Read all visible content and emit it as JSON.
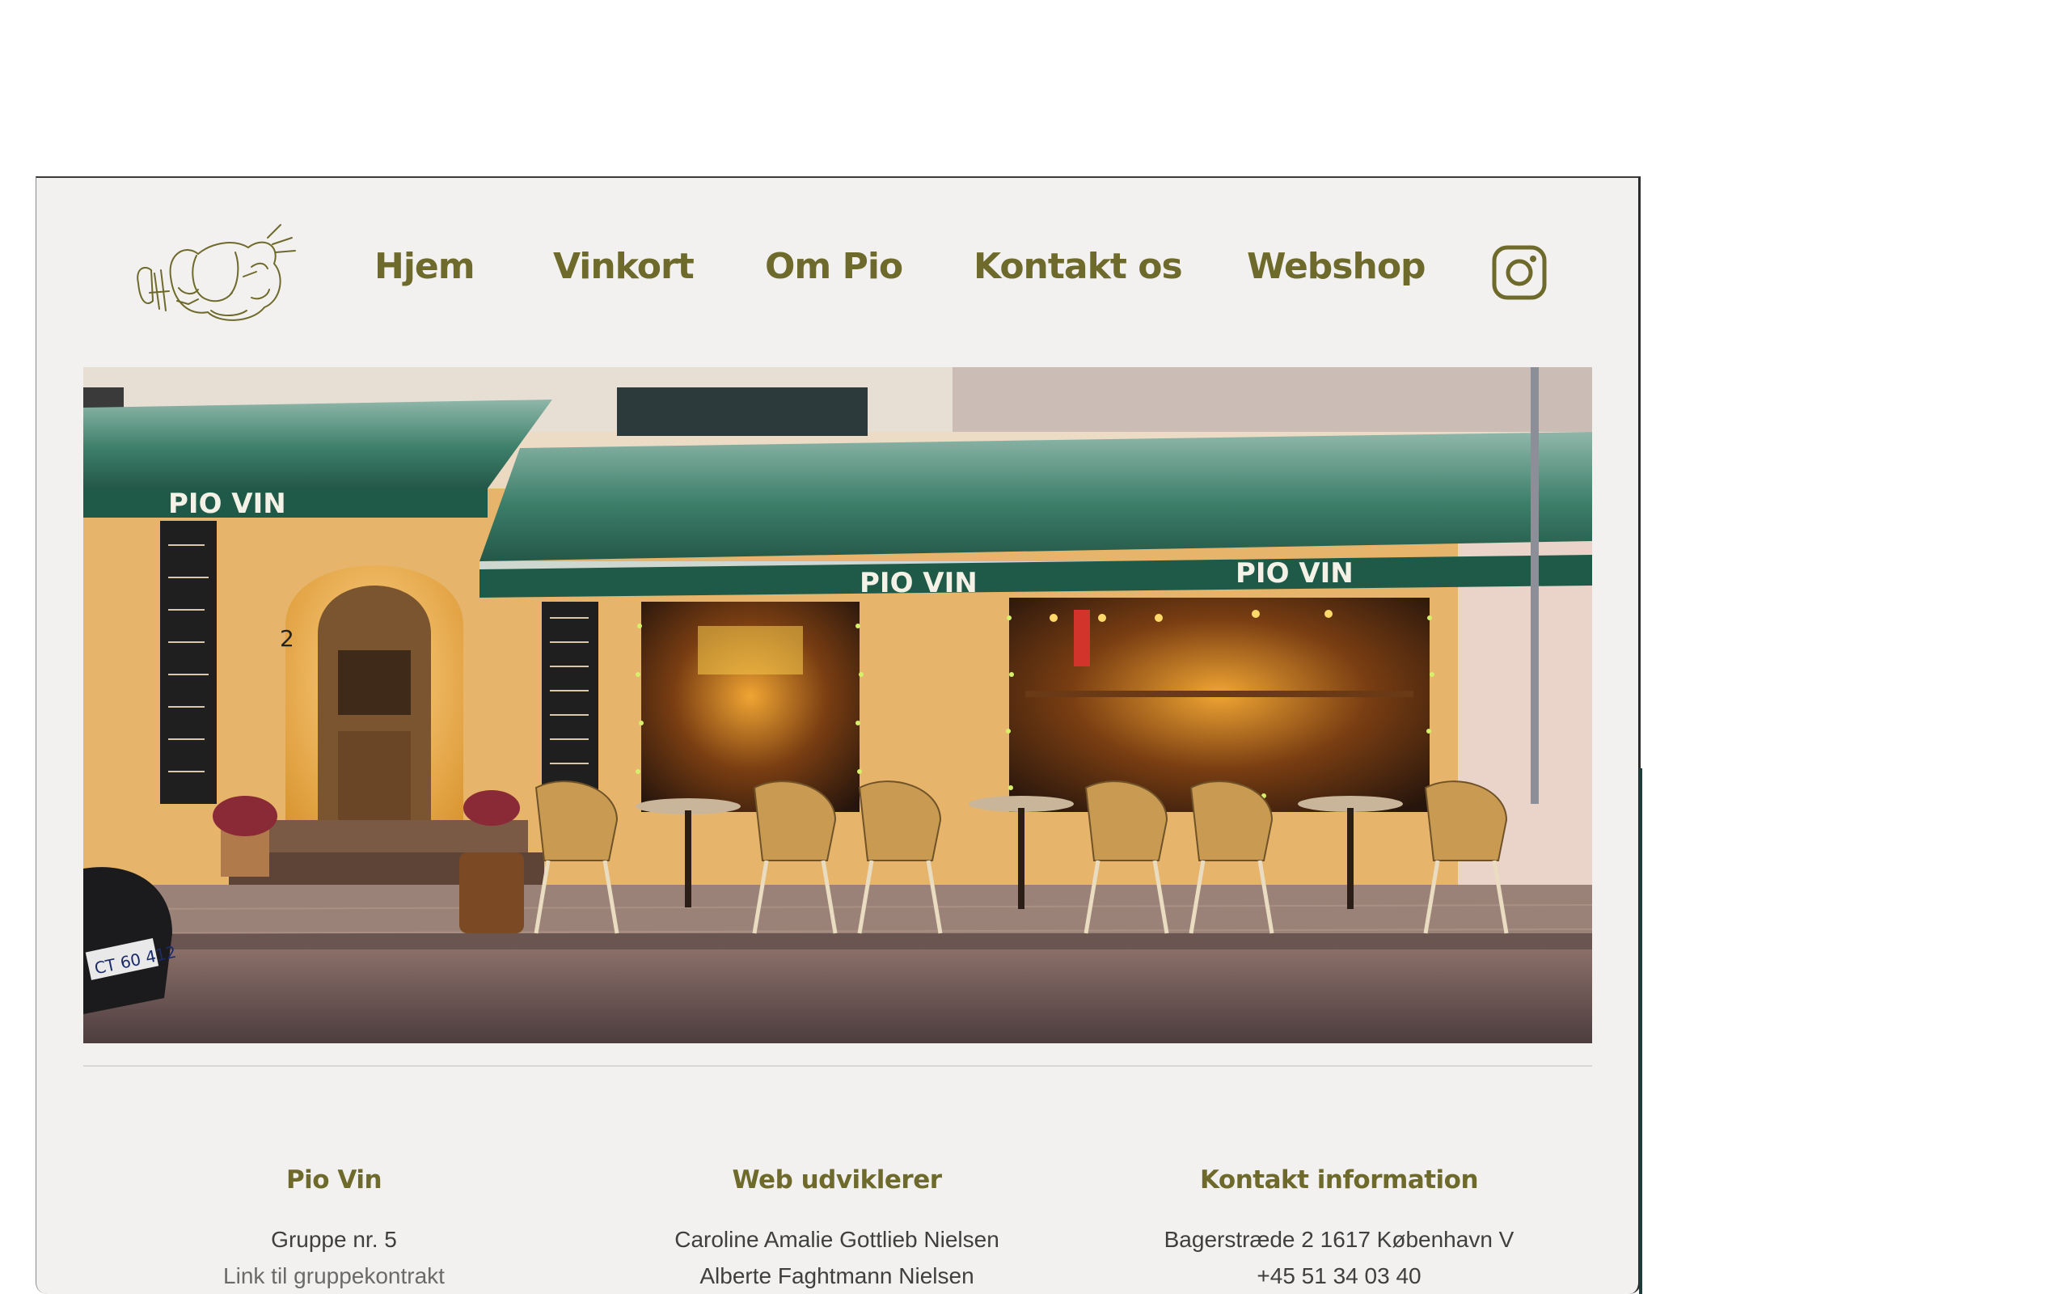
{
  "nav": {
    "items": [
      "Hjem",
      "Vinkort",
      "Om Pio",
      "Kontakt os",
      "Webshop"
    ]
  },
  "hero": {
    "awning_signs": [
      "PIO VIN",
      "PIO VIN",
      "PIO VIN"
    ],
    "house_number": "2",
    "plate": "CT 60 412"
  },
  "footer": {
    "col1": {
      "heading": "Pio Vin",
      "line1": "Gruppe nr. 5",
      "link": "Link til gruppekontrakt"
    },
    "col2": {
      "heading": "Web udviklerer",
      "line1": "Caroline Amalie Gottlieb Nielsen",
      "line2": "Alberte Faghtmann Nielsen"
    },
    "col3": {
      "heading": "Kontakt information",
      "line1": "Bagerstræde 2 1617 København V",
      "line2": "+45 51 34 03 40"
    }
  },
  "colors": {
    "brand": "#6e6a2b",
    "page_bg": "#f2f1ef",
    "awning": "#2f6b57"
  },
  "icons": {
    "logo": "pio-logo-sketch",
    "social": "instagram-icon"
  }
}
